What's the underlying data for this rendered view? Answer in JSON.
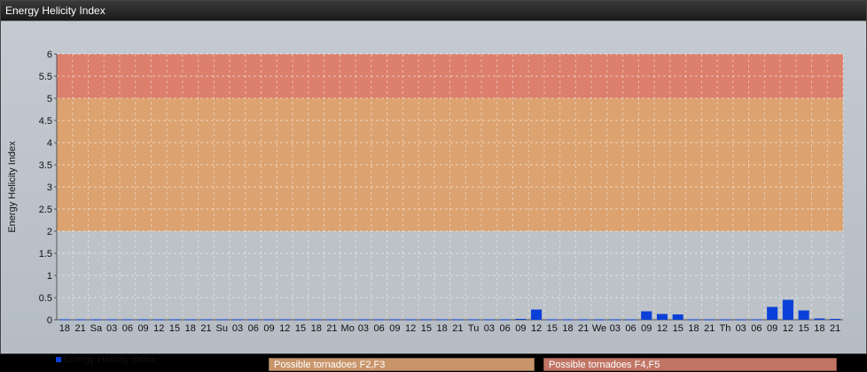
{
  "window": {
    "title": "Energy Helicity Index"
  },
  "chart_data": {
    "type": "bar",
    "ylabel": "Energy Helicity Index",
    "xlabel": "",
    "ylim": [
      0,
      6
    ],
    "yticks": [
      "0",
      "0.5",
      "1",
      "1.5",
      "2",
      "2.5",
      "3",
      "3.5",
      "4",
      "4.5",
      "5",
      "5.5",
      "6"
    ],
    "grid": true,
    "legend_placement": "bottom-left",
    "categories": [
      "18",
      "21",
      "Sa",
      "03",
      "06",
      "09",
      "12",
      "15",
      "18",
      "21",
      "Su",
      "03",
      "06",
      "09",
      "12",
      "15",
      "18",
      "21",
      "Mo",
      "03",
      "06",
      "09",
      "12",
      "15",
      "18",
      "21",
      "Tu",
      "03",
      "06",
      "09",
      "12",
      "15",
      "18",
      "21",
      "We",
      "03",
      "06",
      "09",
      "12",
      "15",
      "18",
      "21",
      "Th",
      "03",
      "06",
      "09",
      "12",
      "15",
      "18",
      "21"
    ],
    "series": [
      {
        "name": "Energy Helicity Index",
        "color": "#0a3fd8",
        "values": [
          0.01,
          0.01,
          0.01,
          0.01,
          0.01,
          0.01,
          0.01,
          0.01,
          0.01,
          0.01,
          0.01,
          0.01,
          0.01,
          0.01,
          0.01,
          0.01,
          0.01,
          0.01,
          0.01,
          0.01,
          0.01,
          0.01,
          0.01,
          0.01,
          0.01,
          0.01,
          0.01,
          0.01,
          0.01,
          0.02,
          0.23,
          0.01,
          0.01,
          0.01,
          0.01,
          0.01,
          0.01,
          0.19,
          0.13,
          0.12,
          0.01,
          0.01,
          0.01,
          0.01,
          0.01,
          0.29,
          0.45,
          0.21,
          0.03,
          0.02
        ]
      }
    ],
    "bands": [
      {
        "from": 0,
        "to": 2,
        "color": "#bcc2c8"
      },
      {
        "from": 2,
        "to": 5,
        "color": "#dca26f",
        "label": "Possible tornadoes F2,F3",
        "legend_color": "#c8956a"
      },
      {
        "from": 5,
        "to": 6,
        "color": "#dc7f6c",
        "label": "Possible tornadoes F4,F5",
        "legend_color": "#c07565"
      }
    ]
  }
}
